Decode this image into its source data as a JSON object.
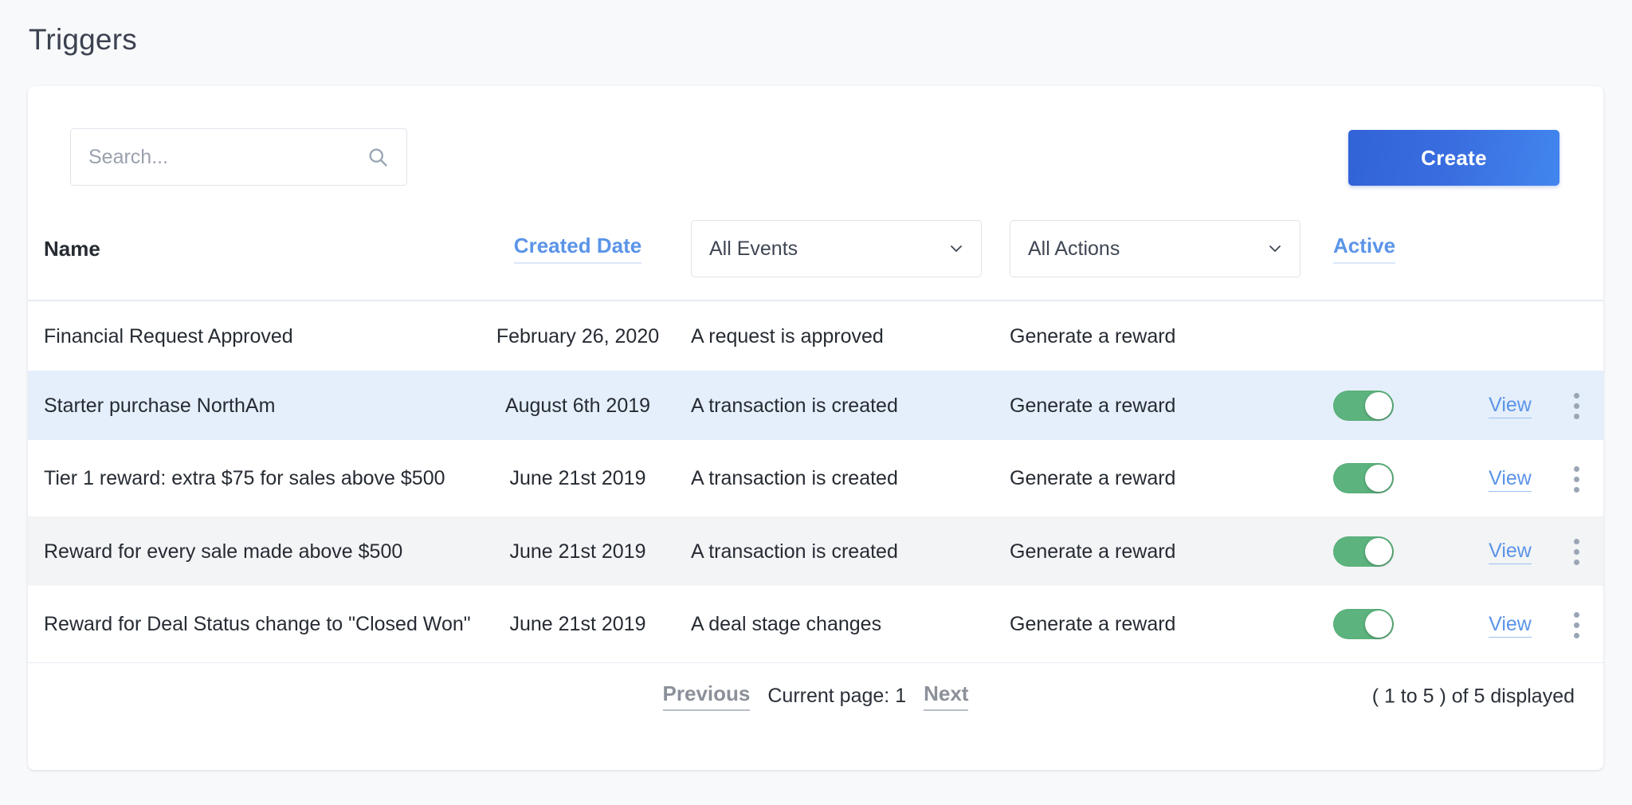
{
  "page": {
    "title": "Triggers"
  },
  "toolbar": {
    "search_placeholder": "Search...",
    "search_value": "",
    "search_icon": "search-icon",
    "create_label": "Create"
  },
  "table": {
    "headers": {
      "name": "Name",
      "created_date": "Created Date",
      "active": "Active"
    },
    "filters": {
      "events": {
        "selected": "All Events",
        "chevron": "chevron-down-icon"
      },
      "actions": {
        "selected": "All Actions",
        "chevron": "chevron-down-icon"
      }
    },
    "rows": [
      {
        "name": "Financial Request Approved",
        "date": "February 26, 2020",
        "event": "A request is approved",
        "action": "Generate a reward",
        "has_toggle": false,
        "toggle_on": false,
        "view_label": "",
        "has_menu": false,
        "bg": "bg-white"
      },
      {
        "name": "Starter purchase NorthAm",
        "date": "August 6th 2019",
        "event": "A transaction is created",
        "action": "Generate a reward",
        "has_toggle": true,
        "toggle_on": true,
        "view_label": "View",
        "has_menu": true,
        "bg": "bg-blue"
      },
      {
        "name": "Tier 1 reward: extra $75 for sales above $500",
        "date": "June 21st 2019",
        "event": "A transaction is created",
        "action": "Generate a reward",
        "has_toggle": true,
        "toggle_on": true,
        "view_label": "View",
        "has_menu": true,
        "bg": "bg-white"
      },
      {
        "name": "Reward for every sale made above $500",
        "date": "June 21st 2019",
        "event": "A transaction is created",
        "action": "Generate a reward",
        "has_toggle": true,
        "toggle_on": true,
        "view_label": "View",
        "has_menu": true,
        "bg": "bg-gray"
      },
      {
        "name": "Reward for Deal Status change to \"Closed Won\"",
        "date": "June 21st 2019",
        "event": "A deal stage changes",
        "action": "Generate a reward",
        "has_toggle": true,
        "toggle_on": true,
        "view_label": "View",
        "has_menu": true,
        "bg": "bg-white"
      }
    ]
  },
  "footer": {
    "previous_label": "Previous",
    "current_page_label": "Current page: 1",
    "next_label": "Next",
    "count_label": "( 1 to 5 ) of 5 displayed"
  },
  "colors": {
    "accent_blue": "#3a6ee0",
    "link_blue": "#5b94e8",
    "toggle_green": "#5cb37d",
    "page_bg": "#f8f9fb",
    "row_highlight": "#e5effb",
    "row_alt": "#f3f4f6"
  }
}
